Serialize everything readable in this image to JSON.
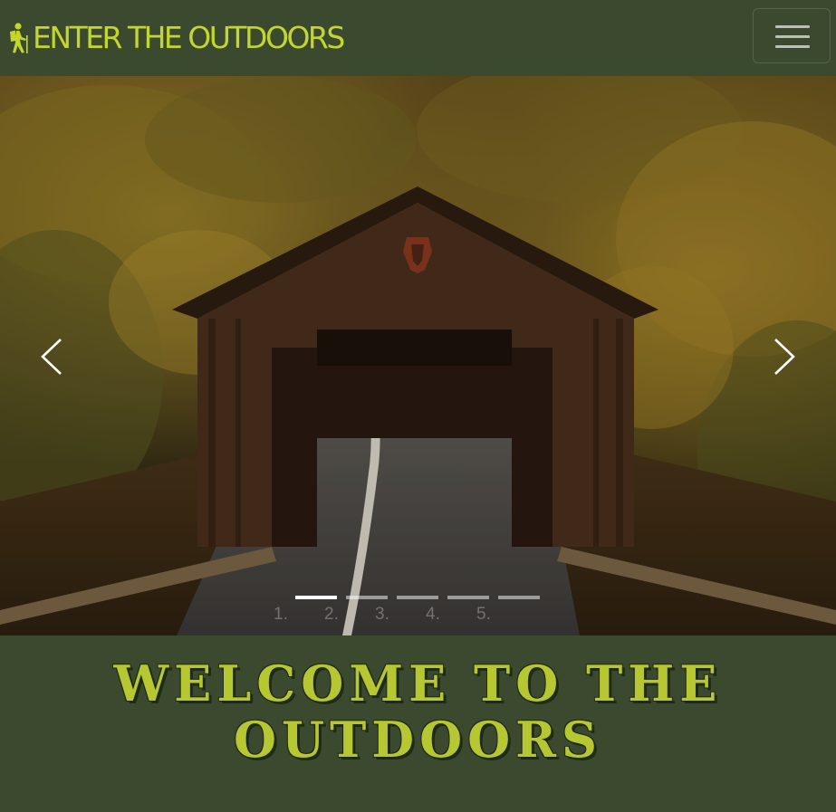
{
  "navbar": {
    "brand_text": "ENTER THE OUTDOORS",
    "brand_icon": "hiker-icon",
    "menu_icon": "hamburger-menu-icon",
    "brand_color": "#c2d62d",
    "background": "#3b4a2f"
  },
  "carousel": {
    "image": "covered-bridge-autumn-forest-road",
    "prev_icon": "chevron-left-icon",
    "next_icon": "chevron-right-icon",
    "active_index": 0,
    "indicator_labels": [
      "1.",
      "2.",
      "3.",
      "4.",
      "5."
    ]
  },
  "hero": {
    "welcome_text": "WELCOME TO THE OUTDOORS",
    "text_color": "#b6c731"
  }
}
